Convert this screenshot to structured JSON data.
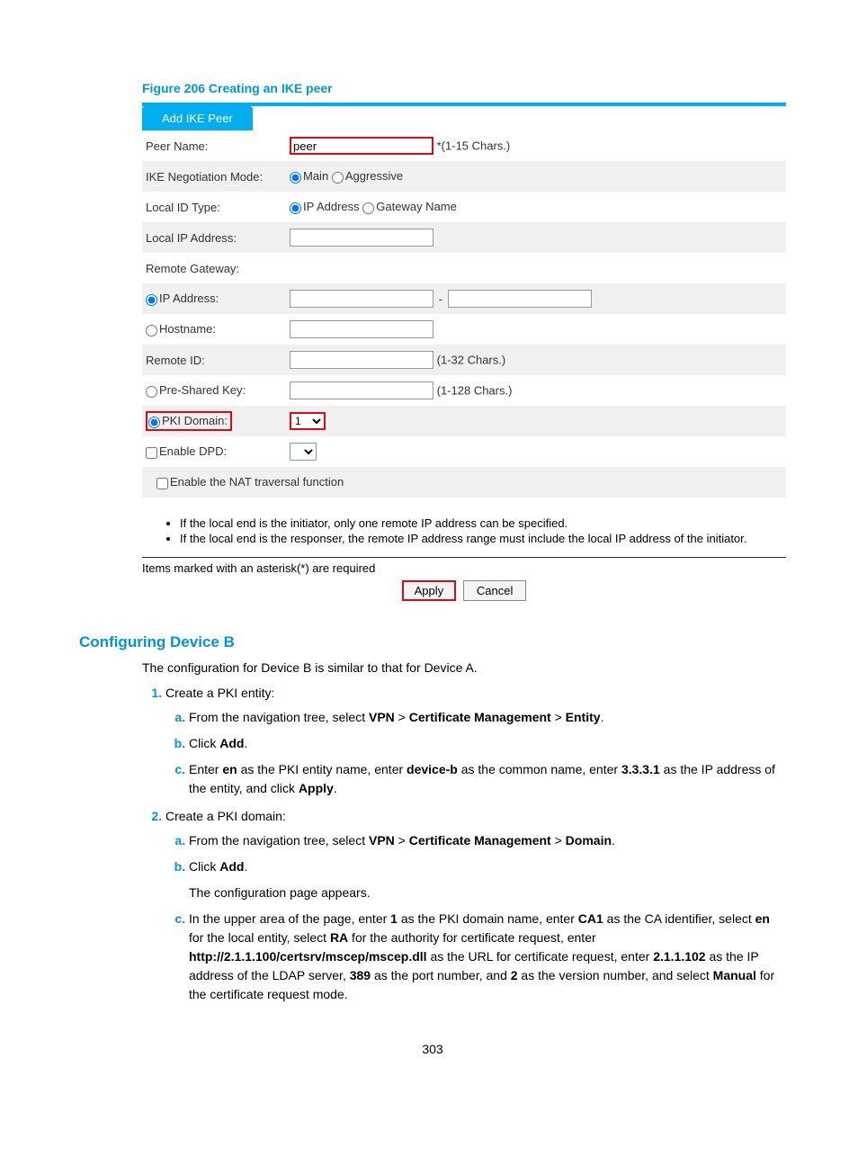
{
  "figure_caption": "Figure 206 Creating an IKE peer",
  "tab_label": "Add IKE Peer",
  "form": {
    "peer_name_label": "Peer Name:",
    "peer_name_value": "peer",
    "peer_name_hint": "*(1-15 Chars.)",
    "nego_label": "IKE Negotiation Mode:",
    "nego_main": "Main",
    "nego_aggressive": "Aggressive",
    "localid_label": "Local ID Type:",
    "localid_ip": "IP Address",
    "localid_gw": "Gateway Name",
    "localip_label": "Local IP Address:",
    "remotegw_label": "Remote Gateway:",
    "remote_ip_label": "IP Address:",
    "remote_hostname_label": "Hostname:",
    "remoteid_label": "Remote ID:",
    "remoteid_hint": "(1-32 Chars.)",
    "psk_label": "Pre-Shared Key:",
    "psk_hint": "(1-128 Chars.)",
    "pki_label": "PKI Domain:",
    "pki_value": "1",
    "dpd_label": "Enable DPD:",
    "nat_label": "Enable the NAT traversal function"
  },
  "notes": {
    "n1": "If the local end is the initiator, only one remote IP address can be specified.",
    "n2": "If the local end is the responser, the remote IP address range must include the local IP address of the initiator."
  },
  "required_note": "Items marked with an asterisk(*) are required",
  "apply_btn": "Apply",
  "cancel_btn": "Cancel",
  "section_heading": "Configuring Device B",
  "intro": "The configuration for Device B is similar to that for Device A.",
  "steps": {
    "s1": "Create a PKI entity:",
    "s1a_pre": "From the navigation tree, select ",
    "s1a_vpn": "VPN",
    "s1a_gt1": " > ",
    "s1a_cert": "Certificate Management",
    "s1a_gt2": " > ",
    "s1a_entity": "Entity",
    "s1a_post": ".",
    "s1b_pre": "Click ",
    "s1b_add": "Add",
    "s1b_post": ".",
    "s1c_1": "Enter ",
    "s1c_en": "en",
    "s1c_2": " as the PKI entity name, enter ",
    "s1c_deviceb": "device-b",
    "s1c_3": " as the common name, enter ",
    "s1c_ip": "3.3.3.1",
    "s1c_4": " as the IP address of the entity, and click ",
    "s1c_apply": "Apply",
    "s1c_5": ".",
    "s2": "Create a PKI domain:",
    "s2a_pre": "From the navigation tree, select ",
    "s2a_vpn": "VPN",
    "s2a_gt1": " > ",
    "s2a_cert": "Certificate Management",
    "s2a_gt2": " > ",
    "s2a_domain": "Domain",
    "s2a_post": ".",
    "s2b_pre": "Click ",
    "s2b_add": "Add",
    "s2b_post": ".",
    "s2b_note": "The configuration page appears.",
    "s2c_1": "In the upper area of the page, enter ",
    "s2c_one": "1",
    "s2c_2": " as the PKI domain name, enter ",
    "s2c_ca": "CA1",
    "s2c_3": " as the CA identifier, select ",
    "s2c_en": "en",
    "s2c_4": " for the local entity, select ",
    "s2c_ra": "RA",
    "s2c_5": " for the authority for certificate request, enter ",
    "s2c_url": "http://2.1.1.100/certsrv/mscep/mscep.dll",
    "s2c_6": " as the URL for certificate request, enter ",
    "s2c_ldap": "2.1.1.102",
    "s2c_7": " as the IP address of the LDAP server, ",
    "s2c_port": "389",
    "s2c_8": " as the port number, and ",
    "s2c_ver": "2",
    "s2c_9": " as the version number, and select ",
    "s2c_manual": "Manual",
    "s2c_10": " for the certificate request mode."
  },
  "page_number": "303"
}
